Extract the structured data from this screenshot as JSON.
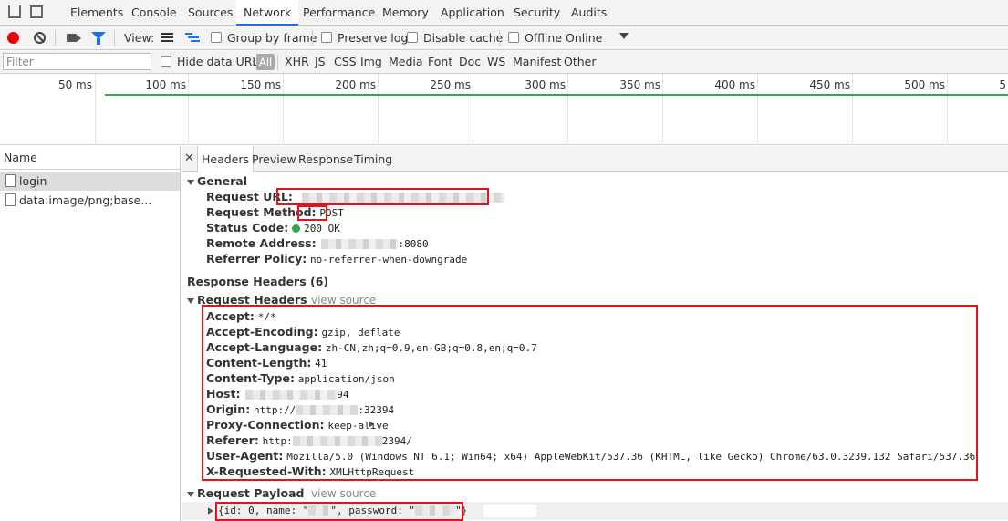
{
  "tabbar": {
    "tabs": [
      "Elements",
      "Console",
      "Sources",
      "Network",
      "Performance",
      "Memory",
      "Application",
      "Security",
      "Audits"
    ],
    "active": "Network"
  },
  "toolbar": {
    "view_label": "View:",
    "group_by_frame": "Group by frame",
    "preserve_log": "Preserve log",
    "disable_cache": "Disable cache",
    "offline": "Offline",
    "throttle": "Online"
  },
  "filterbar": {
    "placeholder": "Filter",
    "hide_data_urls": "Hide data URLs",
    "types": [
      "All",
      "XHR",
      "JS",
      "CSS",
      "Img",
      "Media",
      "Font",
      "Doc",
      "WS",
      "Manifest",
      "Other"
    ]
  },
  "overview": {
    "ticks": [
      "50 ms",
      "100 ms",
      "150 ms",
      "200 ms",
      "250 ms",
      "300 ms",
      "350 ms",
      "400 ms",
      "450 ms",
      "500 ms",
      "5"
    ]
  },
  "requests": {
    "header": "Name",
    "items": [
      "login",
      "data:image/png;base..."
    ]
  },
  "detail": {
    "tabs": [
      "Headers",
      "Preview",
      "Response",
      "Timing"
    ],
    "general": {
      "title": "General",
      "url_label": "Request URL:",
      "method_label": "Request Method:",
      "method": "POST",
      "status_label": "Status Code:",
      "status": "200 OK",
      "remote_label": "Remote Address:",
      "remote_suffix": ":8080",
      "referrer_label": "Referrer Policy:",
      "referrer": "no-referrer-when-downgrade"
    },
    "response_headers": {
      "title": "Response Headers (6)"
    },
    "request_headers": {
      "title": "Request Headers",
      "view_source": "view source",
      "rows": [
        {
          "name": "Accept:",
          "value": "*/*"
        },
        {
          "name": "Accept-Encoding:",
          "value": "gzip, deflate"
        },
        {
          "name": "Accept-Language:",
          "value": "zh-CN,zh;q=0.9,en-GB;q=0.8,en;q=0.7"
        },
        {
          "name": "Content-Length:",
          "value": "41"
        },
        {
          "name": "Content-Type:",
          "value": "application/json"
        },
        {
          "name": "Host:",
          "value": "94"
        },
        {
          "name": "Origin:",
          "value_prefix": "http://",
          "value": ":32394"
        },
        {
          "name": "Proxy-Connection:",
          "value": "keep-alive"
        },
        {
          "name": "Referer:",
          "value_prefix": "http:",
          "value": "2394/"
        },
        {
          "name": "User-Agent:",
          "value": "Mozilla/5.0 (Windows NT 6.1; Win64; x64) AppleWebKit/537.36 (KHTML, like Gecko) Chrome/63.0.3239.132 Safari/537.36"
        },
        {
          "name": "X-Requested-With:",
          "value": "XMLHttpRequest"
        }
      ]
    },
    "payload": {
      "title": "Request Payload",
      "view_source": "view source",
      "p1": "{id: 0, name: \"",
      "p2": "\", password: \"",
      "p3": "\"}"
    }
  }
}
